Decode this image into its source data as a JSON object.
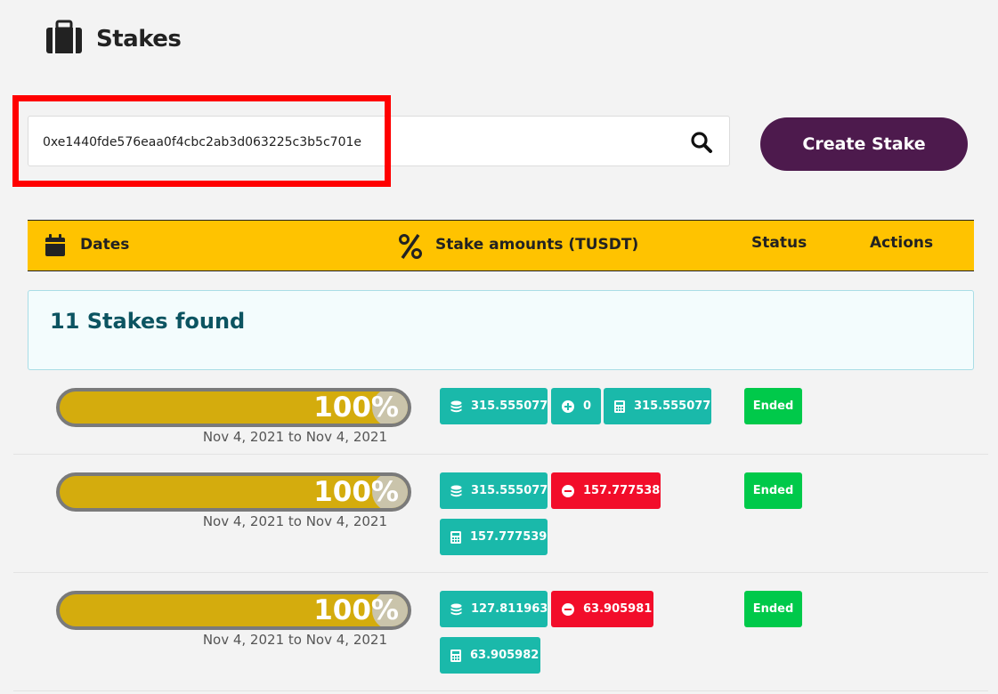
{
  "header": {
    "title": "Stakes",
    "icon": "briefcase-icon"
  },
  "search": {
    "value": "0xe1440fde576eaa0f4cbc2ab3d063225c3b5c701e",
    "icon": "search-icon"
  },
  "create_button": {
    "label": "Create Stake"
  },
  "table_header": {
    "dates": "Dates",
    "amounts": "Stake amounts (TUSDT)",
    "status": "Status",
    "actions": "Actions"
  },
  "found": {
    "text": "11 Stakes found"
  },
  "colors": {
    "accent": "#ffc300",
    "brand": "#4d1a4d",
    "teal": "#1ab9aa",
    "red": "#f20d2a",
    "green": "#00c94a"
  },
  "stakes": [
    {
      "progress": {
        "percent": 100,
        "label": "100%"
      },
      "date_range": "Nov 4, 2021 to Nov 4, 2021",
      "principal": "315.555077",
      "adjustment": {
        "sign": "plus",
        "value": "0"
      },
      "total": "315.555077",
      "status": "Ended"
    },
    {
      "progress": {
        "percent": 100,
        "label": "100%"
      },
      "date_range": "Nov 4, 2021 to Nov 4, 2021",
      "principal": "315.555077",
      "adjustment": {
        "sign": "minus",
        "value": "157.777538"
      },
      "total": "157.777539",
      "status": "Ended"
    },
    {
      "progress": {
        "percent": 100,
        "label": "100%"
      },
      "date_range": "Nov 4, 2021 to Nov 4, 2021",
      "principal": "127.811963",
      "adjustment": {
        "sign": "minus",
        "value": "63.905981"
      },
      "total": "63.905982",
      "status": "Ended"
    }
  ]
}
